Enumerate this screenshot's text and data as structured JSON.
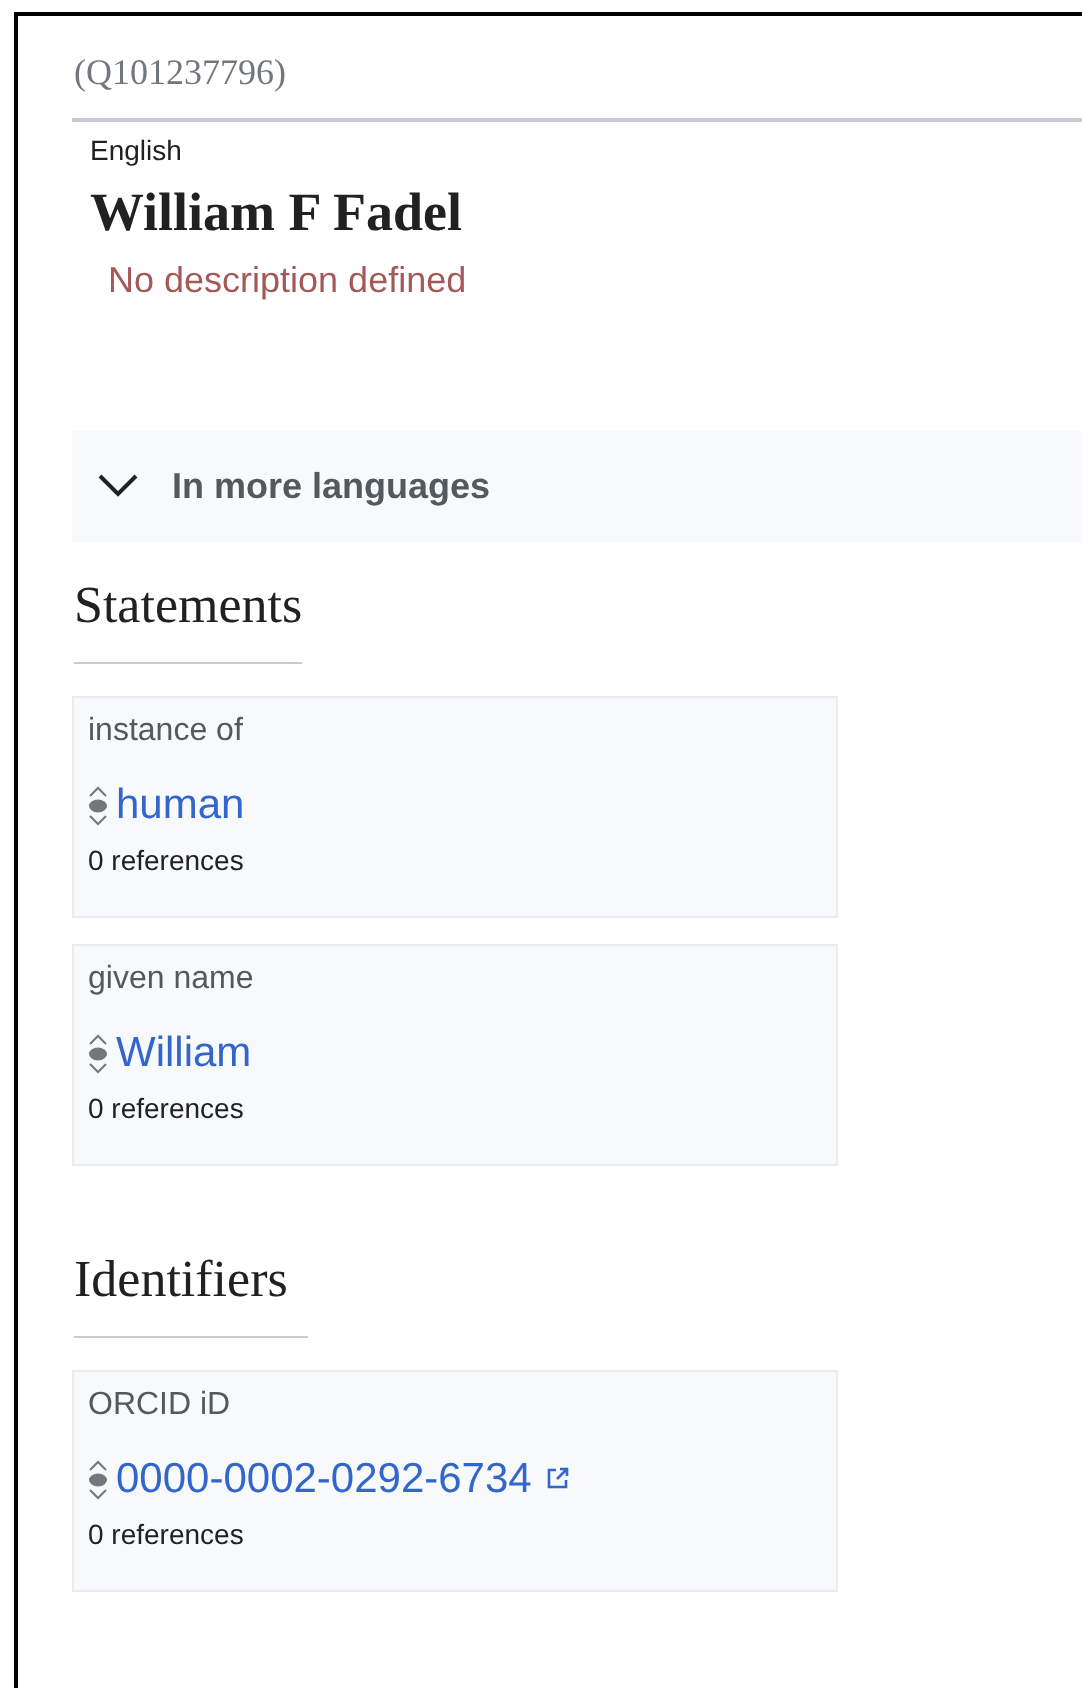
{
  "entity_id": "(Q101237796)",
  "language": "English",
  "label": "William F Fadel",
  "description": "No description defined",
  "more_languages": {
    "label": "In more languages",
    "expanded": false
  },
  "sections": [
    {
      "title": "Statements",
      "statements": [
        {
          "property": "instance of",
          "value": "human",
          "kind": "item",
          "references": "0 references"
        },
        {
          "property": "given name",
          "value": "William",
          "kind": "item",
          "references": "0 references"
        }
      ]
    },
    {
      "title": "Identifiers",
      "statements": [
        {
          "property": "ORCID iD",
          "value": "0000-0002-0292-6734",
          "kind": "external-id",
          "references": "0 references"
        }
      ]
    }
  ]
}
